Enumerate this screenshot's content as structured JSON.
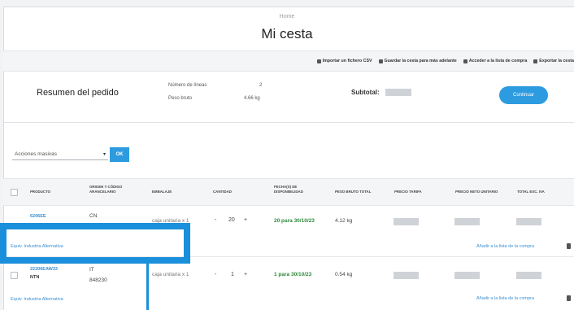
{
  "breadcrumb": "Home",
  "page_title": "Mi cesta",
  "toolbar": {
    "import_csv": "Importar un fichero CSV",
    "save_cart": "Guardar la cesta para más adelante",
    "access_purchase_list": "Acceder a la lista de compra",
    "export": "Exportar la cesta"
  },
  "summary": {
    "title": "Resumen del pedido",
    "lines_label": "Número de líneas",
    "lines_value": "2",
    "weight_label": "Peso bruto",
    "weight_value": "4.66 kg",
    "subtotal_label": "Subtotal:",
    "continue_label": "Continuar"
  },
  "bulk": {
    "select_value": "Acciones masivas",
    "ok_label": "OK"
  },
  "table": {
    "headers": {
      "product": "PRODUCTO",
      "origin": "ORIGEN Y CÓDIGO ARANCELARIO",
      "packaging": "EMBALAJE",
      "quantity": "CANTIDAD",
      "availability": "FECHA(S) DE DISPONIBILIDAD",
      "gross_weight": "PESO BRUTO TOTAL",
      "tariff_price": "PRECIO TARIFA",
      "net_unit_price": "PRECIO NETO UNITARIO",
      "total_excl": "TOTAL EXC. IVA"
    },
    "rows": [
      {
        "product_code": "6206EE",
        "origin": "CN",
        "packaging": "caja unitaria x 1",
        "quantity": "20",
        "availability": "20 para 30/10/23",
        "gross_weight": "4.12 kg",
        "links": "Equiv. Industria Alternativa",
        "add_to_list": "Añadir a la lista de la compra"
      },
      {
        "product_code": "22206EAW33",
        "product_brand": "NTN",
        "origin": "IT",
        "tariff": "848230",
        "packaging": "caja unitaria x 1",
        "quantity": "1",
        "availability": "1 para 30/10/23",
        "gross_weight": "0.54 kg",
        "links": "Equiv. Industria Alternativa",
        "add_to_list": "Añadir a la lista de la compra"
      }
    ]
  },
  "stepper": {
    "minus": "-",
    "plus": "+",
    "caret": "▾"
  },
  "colors": {
    "accent": "#2d9be0",
    "highlight": "#1a8fdb",
    "available": "#2e8a3a",
    "link": "#3a8fd0"
  }
}
